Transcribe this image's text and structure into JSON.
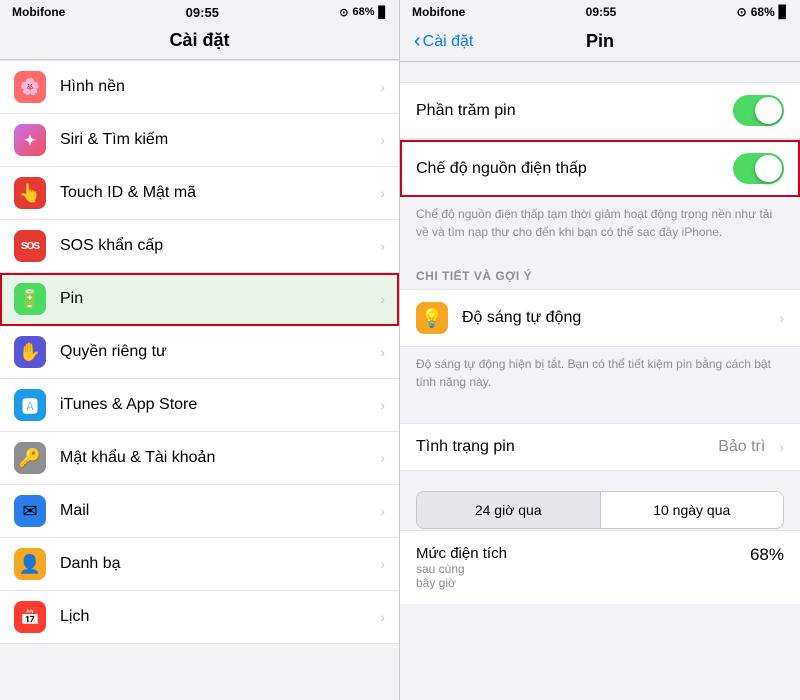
{
  "left": {
    "statusBar": {
      "carrier": "Mobifone",
      "time": "09:55",
      "battery": "68%",
      "batteryIcon": "🔋"
    },
    "title": "Cài đặt",
    "items": [
      {
        "id": "hinh-nen",
        "label": "Hình nền",
        "iconBg": "#ff6b6b",
        "iconEmoji": "🌸"
      },
      {
        "id": "siri",
        "label": "Siri & Tìm kiếm",
        "iconBg": "#000",
        "iconEmoji": "✦"
      },
      {
        "id": "touch-id",
        "label": "Touch ID & Mật mã",
        "iconBg": "#e53935",
        "iconEmoji": "👆"
      },
      {
        "id": "sos",
        "label": "SOS khẩn cấp",
        "iconBg": "#e53935",
        "iconEmoji": "SOS"
      },
      {
        "id": "pin",
        "label": "Pin",
        "iconBg": "#4cd964",
        "iconEmoji": "🔋",
        "highlighted": true
      },
      {
        "id": "quyen-rieng-tu",
        "label": "Quyền riêng tư",
        "iconBg": "#5856d6",
        "iconEmoji": "✋"
      },
      {
        "id": "itunes",
        "label": "iTunes & App Store",
        "iconBg": "#1e9be8",
        "iconEmoji": "🅰"
      },
      {
        "id": "mat-khau",
        "label": "Mật khẩu & Tài khoản",
        "iconBg": "#8e8e93",
        "iconEmoji": "🔑"
      },
      {
        "id": "mail",
        "label": "Mail",
        "iconBg": "#2b7de9",
        "iconEmoji": "✉"
      },
      {
        "id": "danh-ba",
        "label": "Danh bạ",
        "iconBg": "#f5a623",
        "iconEmoji": "👤"
      },
      {
        "id": "lich",
        "label": "Lịch",
        "iconBg": "#ff3b30",
        "iconEmoji": "📅"
      }
    ]
  },
  "right": {
    "statusBar": {
      "carrier": "Mobifone",
      "time": "09:55",
      "battery": "68%"
    },
    "backLabel": "Cài đặt",
    "title": "Pin",
    "phantramPin": {
      "label": "Phần trăm pin",
      "toggleOn": true
    },
    "cheDo": {
      "label": "Chế độ nguồn điện thấp",
      "toggleOn": true,
      "highlighted": true
    },
    "cheDoDesc": "Chế độ nguồn điện thấp tạm thời giảm hoạt động trong nền như tải về và tìm nạp thư cho đến khi bạn có thể sạc đầy iPhone.",
    "sectionHeader": "CHI TIẾT VÀ GỢI Ý",
    "doSang": {
      "label": "Độ sáng tự động",
      "iconBg": "#f5a623",
      "iconEmoji": "💡"
    },
    "doSangDesc": "Độ sáng tự động hiện bị tắt. Bạn có thể tiết kiệm pin bằng cách bật tính năng này.",
    "tinhTrang": {
      "label": "Tình trạng pin",
      "value": "Bảo trì"
    },
    "tabs": [
      {
        "id": "24h",
        "label": "24 giờ qua",
        "active": true
      },
      {
        "id": "10d",
        "label": "10 ngày qua",
        "active": false
      }
    ],
    "mucDienTich": {
      "title": "Mức điện tích",
      "subtitle": "sau cùng",
      "subtitleLine2": "bây giờ",
      "value": "68%"
    }
  }
}
